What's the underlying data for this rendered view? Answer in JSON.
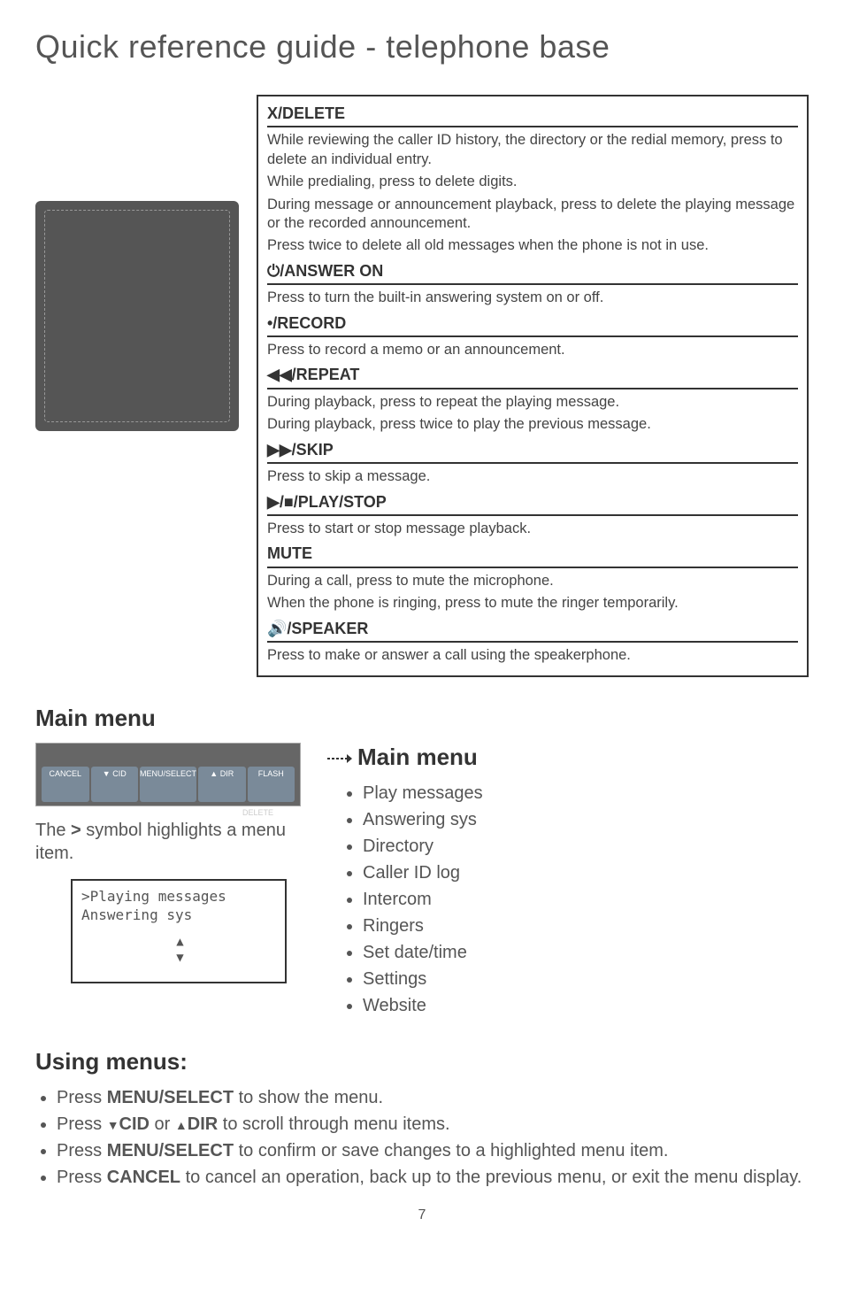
{
  "page_title": "Quick reference guide - telephone base",
  "ref_sections": [
    {
      "title": "X/DELETE",
      "bodies": [
        "While reviewing the caller ID history, the directory or the redial memory, press to delete an individual entry.",
        "While predialing, press to delete digits.",
        "During message or announcement playback, press to delete the playing message or the recorded announcement.",
        "Press twice to delete all old messages when the phone is not in use."
      ]
    },
    {
      "title": "⏻/ANSWER ON",
      "bodies": [
        "Press to turn the built-in answering system on or off."
      ]
    },
    {
      "title": "•/RECORD",
      "bodies": [
        "Press to record a memo or an announcement."
      ]
    },
    {
      "title": "◀◀/REPEAT",
      "bodies": [
        "During playback, press to repeat the playing message.",
        "During playback, press twice to play the previous message."
      ]
    },
    {
      "title": "▶▶/SKIP",
      "bodies": [
        "Press to skip a message."
      ]
    },
    {
      "title": "▶/■/PLAY/STOP",
      "bodies": [
        "Press to start or stop message playback."
      ]
    },
    {
      "title": "MUTE",
      "bodies": [
        "During a call, press to mute the microphone.",
        "When the phone is ringing, press to mute the ringer temporarily."
      ]
    },
    {
      "title": "🔊/SPEAKER",
      "bodies": [
        "Press to make or answer a call using the speakerphone."
      ]
    }
  ],
  "main_menu_heading": "Main menu",
  "highlight_note_pre": "The ",
  "highlight_note_sym": ">",
  "highlight_note_post": " symbol highlights a menu item.",
  "lcd_line1": ">Playing messages",
  "lcd_line2": " Answering sys",
  "main_menu_arrow_heading": "Main menu",
  "menu_items": [
    "Play messages",
    "Answering sys",
    "Directory",
    "Caller ID log",
    "Intercom",
    "Ringers",
    "Set date/time",
    "Settings",
    "Website"
  ],
  "using_heading": "Using menus:",
  "using_items_html": [
    "Press <b>MENU/<span class='sc'>SELECT</span></b> to show the menu.",
    "Press <b><span class='tri-down'></span>CID</b> or <b><span class='tri-up'></span>DIR</b> to scroll through menu items.",
    "Press <b><span class='sc'>MENU</span>/SELECT</b> to confirm or save changes to a highlighted menu item.",
    "Press <b>CANCEL</b> to cancel an operation, back up to the previous menu, or exit the menu display."
  ],
  "device_buttons": [
    "CANCEL",
    "▼ CID",
    "MENU/SELECT",
    "▲ DIR",
    "FLASH"
  ],
  "device_sublabel": "DELETE",
  "page_number": "7"
}
